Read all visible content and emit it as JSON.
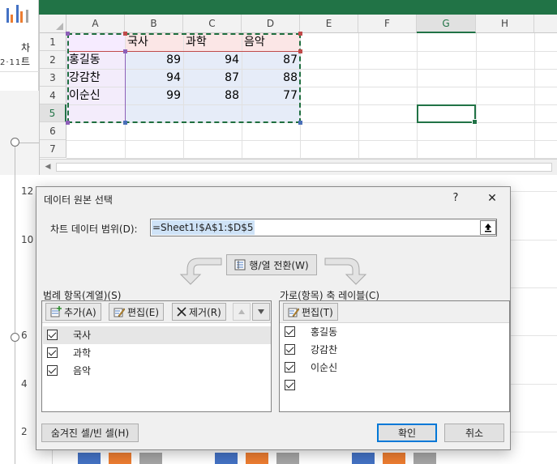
{
  "background": {
    "ribbon_label": "차트",
    "ribbon_font_row": "2·11·",
    "sheet": {
      "columns": [
        "A",
        "B",
        "C",
        "D",
        "E",
        "F",
        "G",
        "H"
      ],
      "rows": [
        "1",
        "2",
        "3",
        "4",
        "5",
        "6",
        "7"
      ],
      "header_cells": [
        "국사",
        "과학",
        "음악"
      ],
      "data_rows": [
        {
          "name": "홍길동",
          "values": [
            "89",
            "94",
            "87"
          ]
        },
        {
          "name": "강감찬",
          "values": [
            "94",
            "87",
            "88"
          ]
        },
        {
          "name": "이순신",
          "values": [
            "99",
            "88",
            "77"
          ]
        }
      ],
      "active_column": "G",
      "active_row": "5"
    },
    "chart_axis_labels": [
      "12",
      "10",
      "6",
      "4",
      "2"
    ],
    "series_colors": [
      "#4472c4",
      "#ed7d31",
      "#a5a5a5"
    ]
  },
  "dialog": {
    "title": "데이터 원본 선택",
    "help": "?",
    "close": "✕",
    "range_label": "차트 데이터 범위(D):",
    "range_value": "=Sheet1!$A$1:$D$5",
    "switch_button": "행/열 전환(W)",
    "legend_group": {
      "label": "범례 항목(계열)(S)",
      "add": "추가(A)",
      "edit": "편집(E)",
      "remove": "제거(R)",
      "items": [
        "국사",
        "과학",
        "음악"
      ]
    },
    "axis_group": {
      "label": "가로(항목) 축 레이블(C)",
      "edit": "편집(T)",
      "items": [
        "홍길동",
        "강감찬",
        "이순신",
        ""
      ]
    },
    "hidden_cells_button": "숨겨진 셀/빈 셀(H)",
    "ok_button": "확인",
    "cancel_button": "취소"
  }
}
